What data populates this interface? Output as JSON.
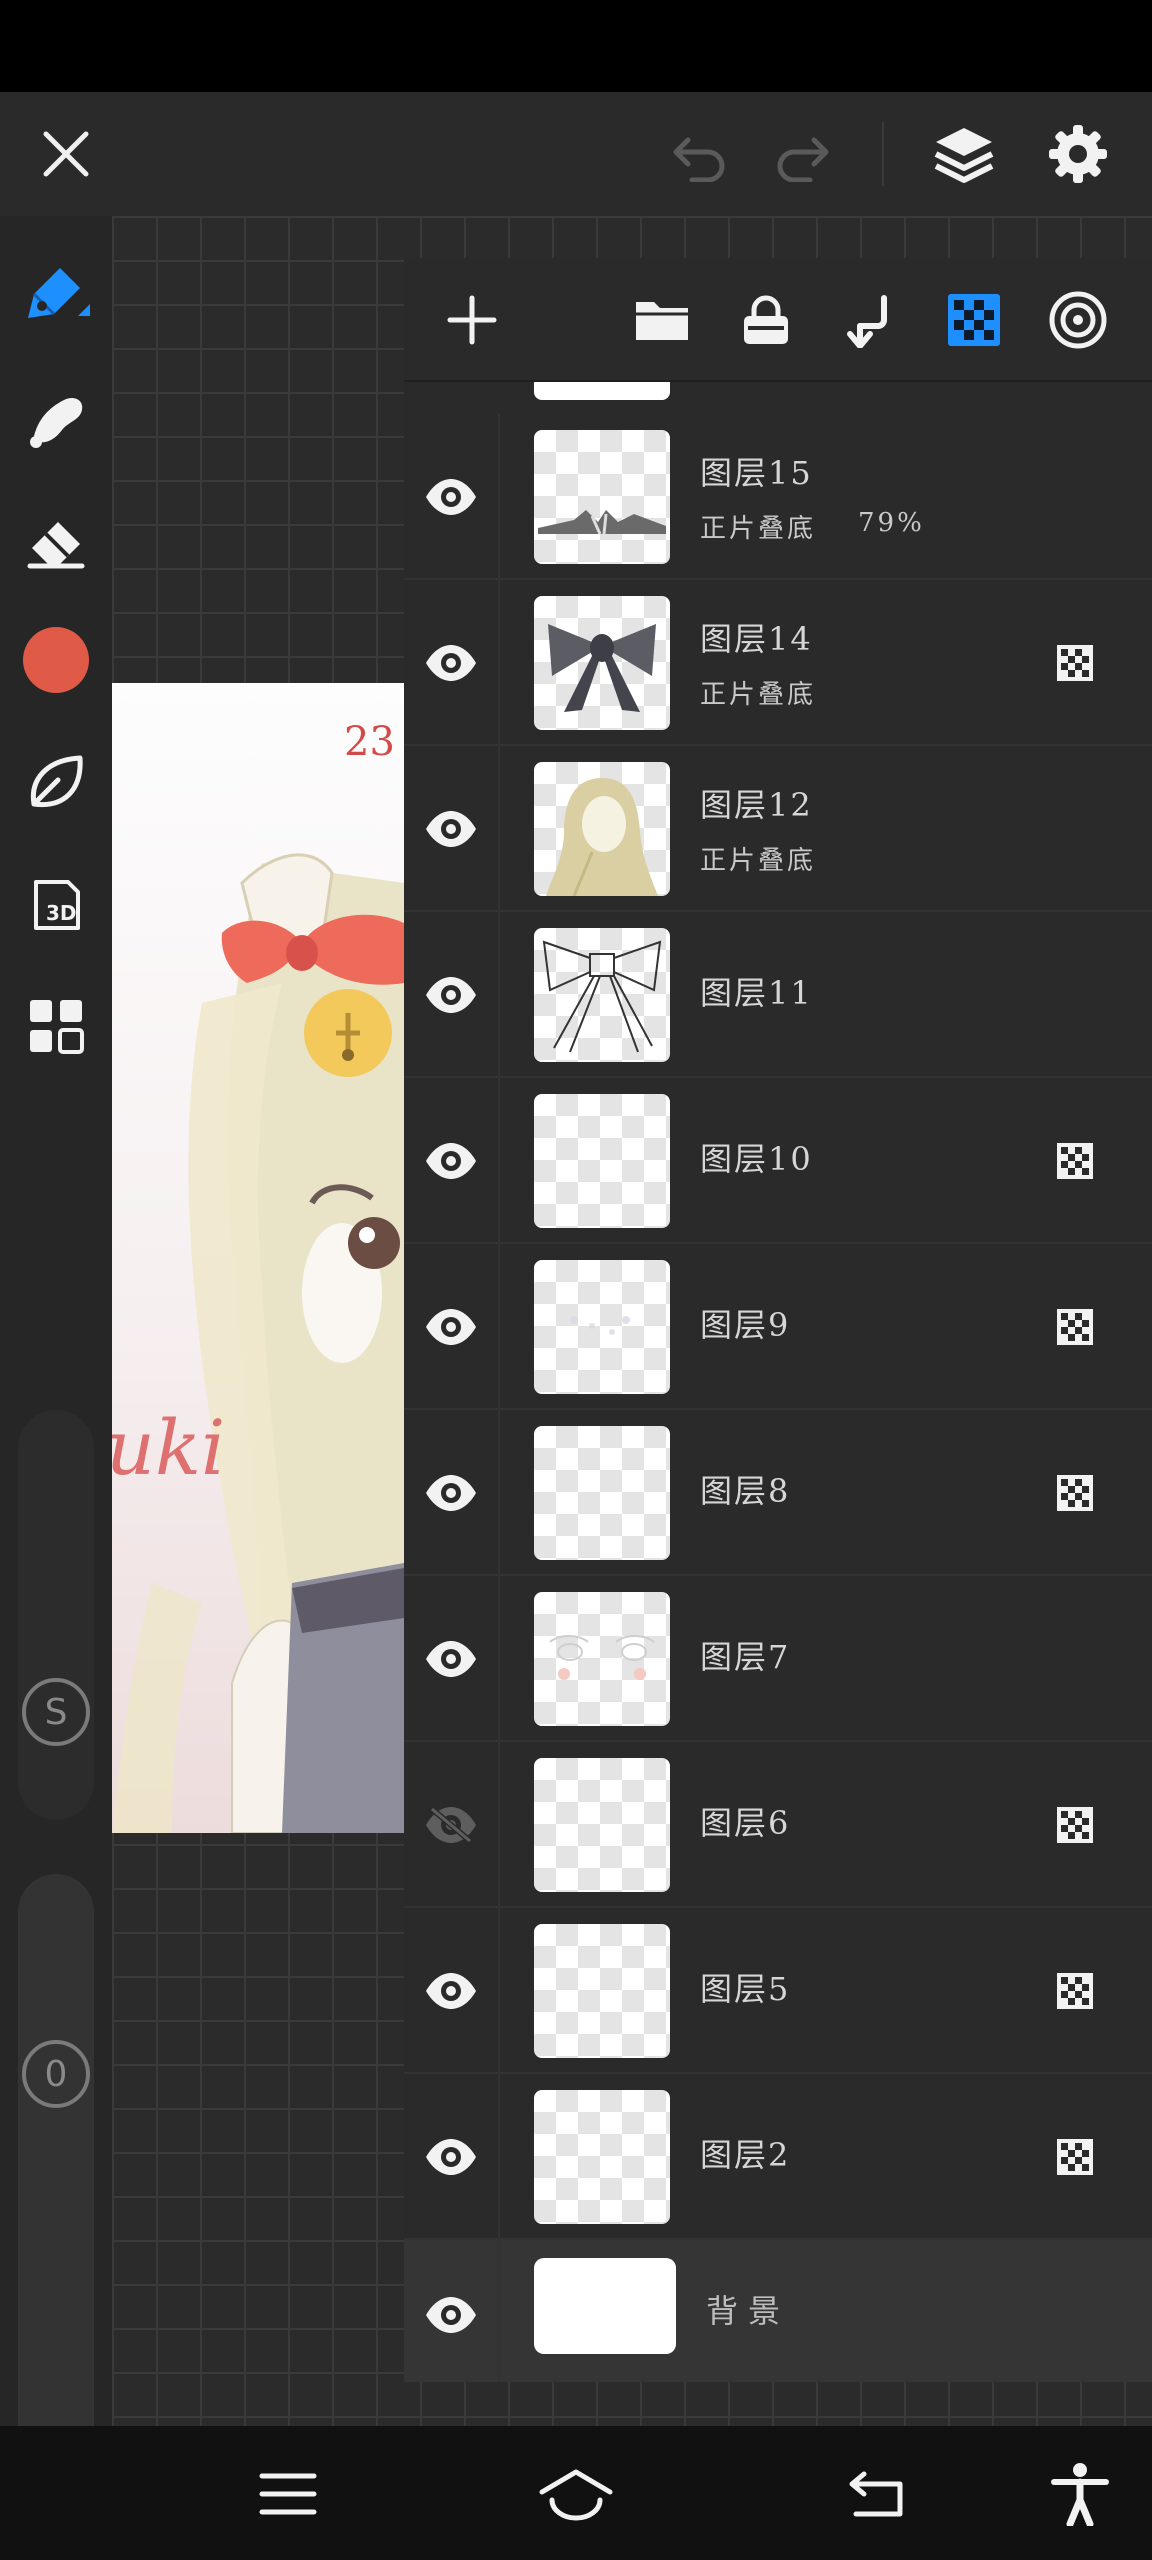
{
  "colors": {
    "accent": "#1e8fff",
    "brush_color": "#e05a48",
    "panel_bg": "#2a2a2a",
    "toolbar_bg": "#262626"
  },
  "top_bar": {
    "icons": [
      "close-icon",
      "undo-icon",
      "redo-icon",
      "layers-icon",
      "settings-icon"
    ]
  },
  "left_toolbar": {
    "tools": [
      "pen-icon",
      "smudge-icon",
      "eraser-icon",
      "color-swatch",
      "leaf-icon",
      "3d-model-icon",
      "gallery-icon"
    ],
    "s_label": "S",
    "opacity_label": "0"
  },
  "layers_panel": {
    "header_icons": [
      "add-layer-icon",
      "folder-icon",
      "lock-icon",
      "merge-down-icon",
      "clipping-icon",
      "visibility-ring-icon"
    ],
    "layers": [
      {
        "name": "图层15",
        "blend": "正片叠底",
        "opacity": "79%",
        "visible": true,
        "clipped": false
      },
      {
        "name": "图层14",
        "blend": "正片叠底",
        "opacity": "",
        "visible": true,
        "clipped": true
      },
      {
        "name": "图层12",
        "blend": "正片叠底",
        "opacity": "",
        "visible": true,
        "clipped": false
      },
      {
        "name": "图层11",
        "blend": "",
        "opacity": "",
        "visible": true,
        "clipped": false
      },
      {
        "name": "图层10",
        "blend": "",
        "opacity": "",
        "visible": true,
        "clipped": true
      },
      {
        "name": "图层9",
        "blend": "",
        "opacity": "",
        "visible": true,
        "clipped": true
      },
      {
        "name": "图层8",
        "blend": "",
        "opacity": "",
        "visible": true,
        "clipped": true
      },
      {
        "name": "图层7",
        "blend": "",
        "opacity": "",
        "visible": true,
        "clipped": false
      },
      {
        "name": "图层6",
        "blend": "",
        "opacity": "",
        "visible": false,
        "clipped": true
      },
      {
        "name": "图层5",
        "blend": "",
        "opacity": "",
        "visible": true,
        "clipped": true
      },
      {
        "name": "图层2",
        "blend": "",
        "opacity": "",
        "visible": true,
        "clipped": true
      },
      {
        "name": "背景",
        "blend": "",
        "opacity": "",
        "visible": true,
        "clipped": false
      }
    ]
  },
  "artwork": {
    "number_text": "23",
    "signature_text": "uki"
  },
  "nav_bar": {
    "icons": [
      "menu-icon",
      "home-icon",
      "back-icon",
      "accessibility-icon"
    ]
  }
}
